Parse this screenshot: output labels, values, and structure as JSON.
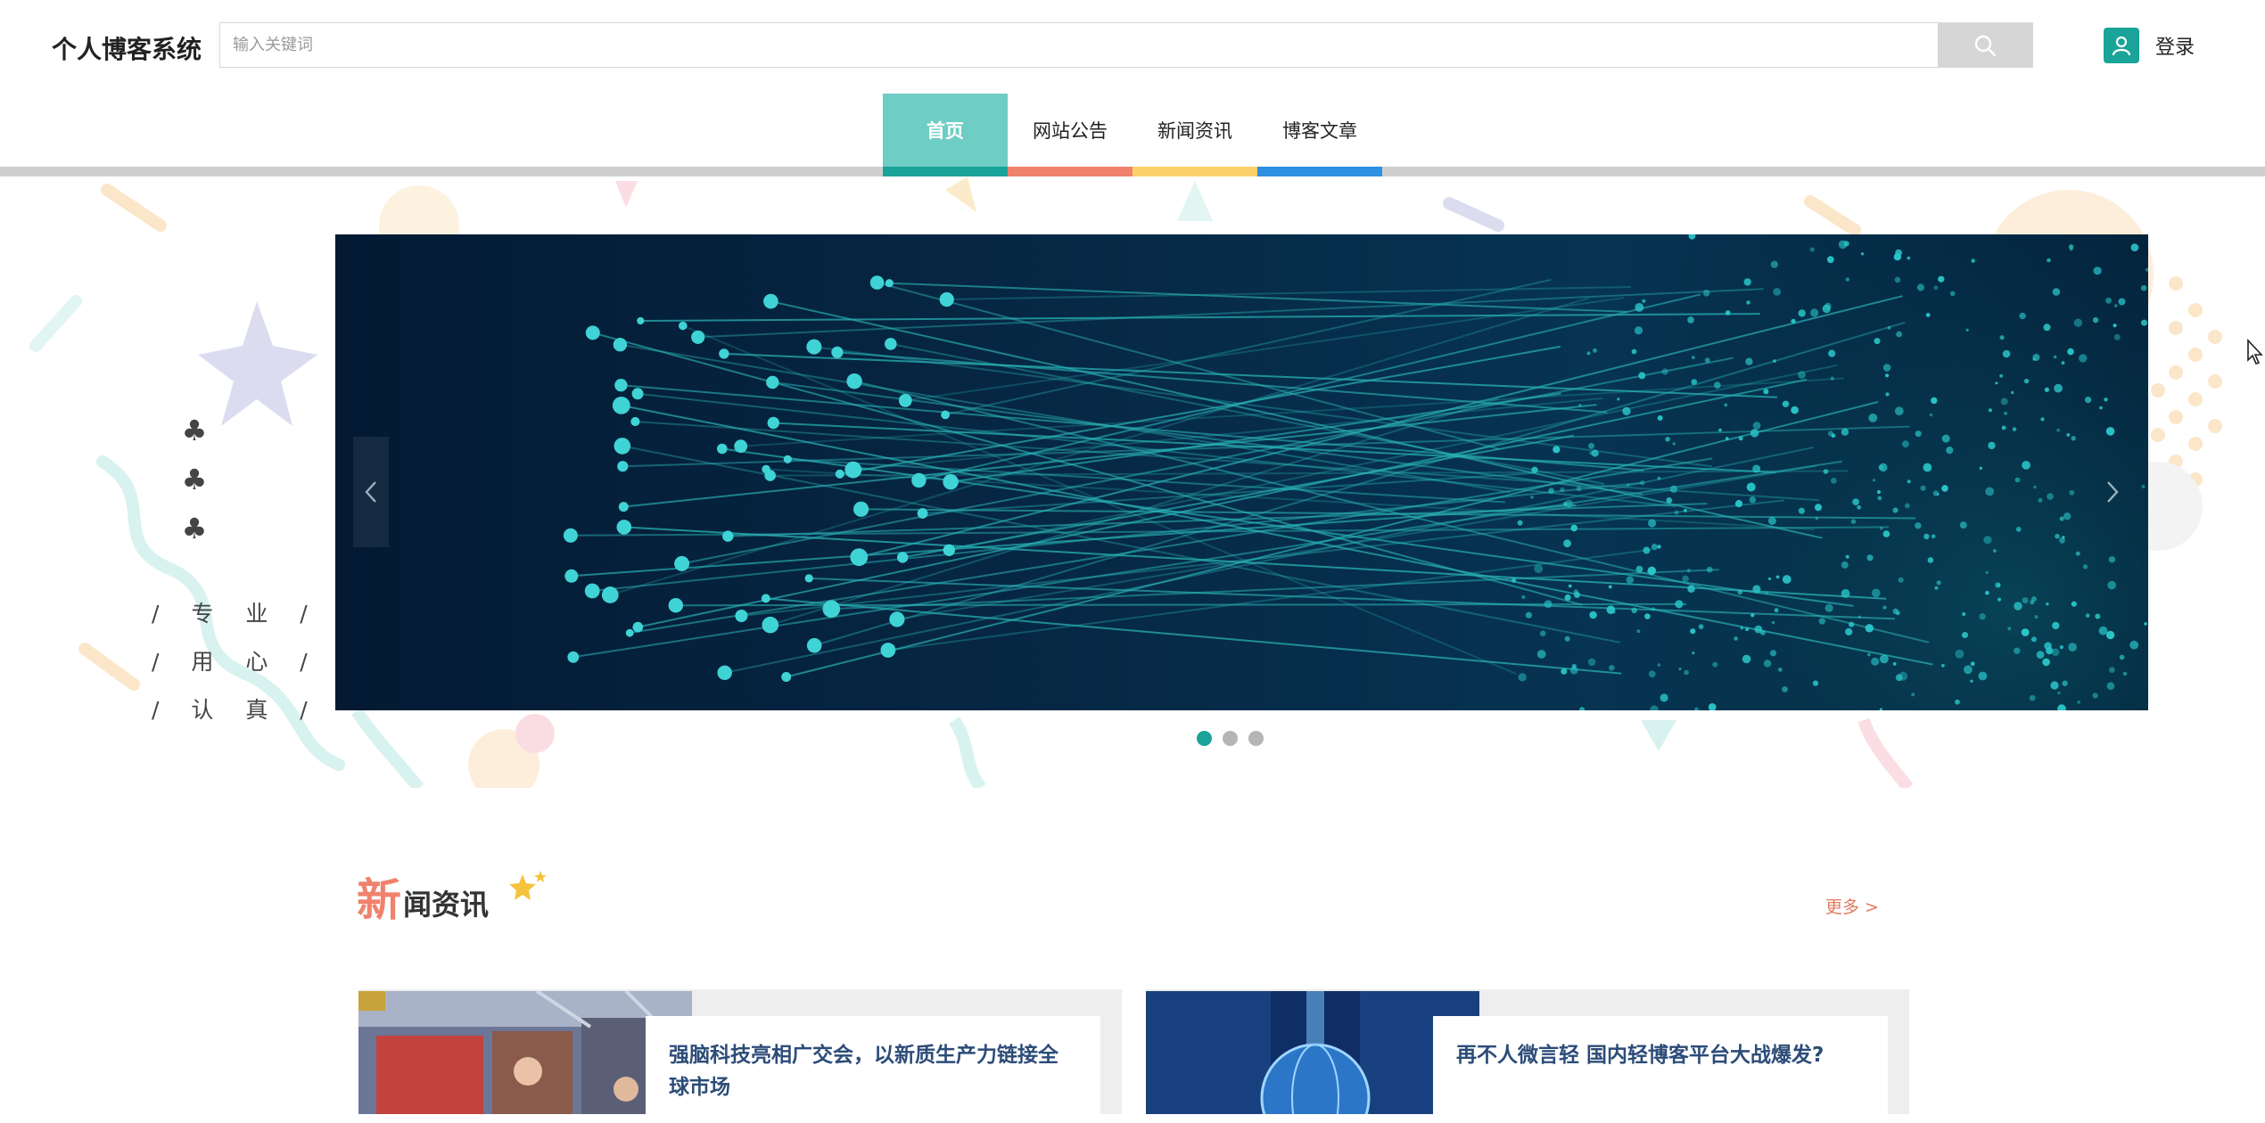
{
  "header": {
    "brand": "个人博客系统",
    "search_placeholder": "输入关键词",
    "search_icon": "search-icon",
    "login_label": "登录",
    "login_icon": "user-icon"
  },
  "nav": {
    "items": [
      {
        "label": "首页",
        "color": "#1aa398",
        "active": true
      },
      {
        "label": "网站公告",
        "color": "#f0826d",
        "active": false
      },
      {
        "label": "新闻资讯",
        "color": "#fcd06a",
        "active": false
      },
      {
        "label": "博客文章",
        "color": "#2f8fe0",
        "active": false
      }
    ]
  },
  "hero": {
    "clubs_icon": "club-icon",
    "motto": [
      "/ 专 业 /",
      "/ 用 心 /",
      "/ 认 真 /"
    ],
    "slides_total": 3,
    "slide_active": 1
  },
  "news": {
    "title_first": "新",
    "title_rest": "闻资讯",
    "more_label": "更多 >",
    "items": [
      {
        "title": "强脑科技亮相广交会，以新质生产力链接全球市场"
      },
      {
        "title": "再不人微言轻 国内轻博客平台大战爆发?"
      }
    ]
  },
  "colors": {
    "accent": "#1aa398",
    "accent_light": "#6ecdc4",
    "news_title": "#2c4c78",
    "more_link": "#e07a5f"
  }
}
